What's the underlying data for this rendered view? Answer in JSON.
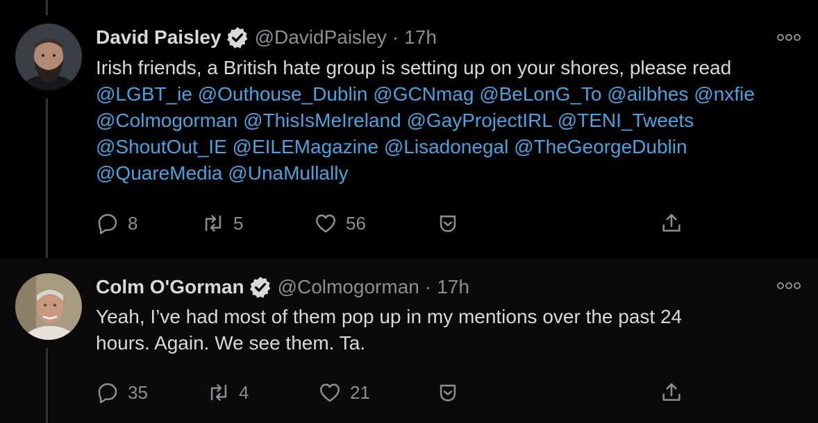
{
  "tweets": [
    {
      "author": {
        "name": "David Paisley",
        "handle": "@DavidPaisley",
        "verified": true,
        "avatar": "bearded-man-avatar"
      },
      "separator": "·",
      "time": "17h",
      "text_intro": "Irish friends, a British hate group is setting up on your shores, please read",
      "mentions": [
        "@LGBT_ie",
        "@Outhouse_Dublin",
        "@GCNmag",
        "@BeLonG_To",
        "@ailbhes",
        "@nxfie",
        "@Colmogorman",
        "@ThisIsMeIreland",
        "@GayProjectIRL",
        "@TENI_Tweets",
        "@ShoutOut_IE",
        "@EILEMagazine",
        "@Lisadonegal",
        "@TheGeorgeDublin",
        "@QuareMedia",
        "@UnaMullally"
      ],
      "actions": {
        "replies": "8",
        "retweets": "5",
        "likes": "56"
      }
    },
    {
      "author": {
        "name": "Colm O'Gorman",
        "handle": "@Colmogorman",
        "verified": true,
        "avatar": "grey-haired-man-avatar"
      },
      "separator": "·",
      "time": "17h",
      "text_lines": [
        "Yeah, I’ve had most of them pop up in my mentions over the past 24",
        "hours. Again. We see them. Ta."
      ],
      "actions": {
        "replies": "35",
        "retweets": "4",
        "likes": "21"
      }
    }
  ],
  "icons": {
    "verified": "verified-badge-icon",
    "more": "more-options-icon",
    "reply": "reply-icon",
    "retweet": "retweet-icon",
    "like": "like-icon",
    "save": "save-icon",
    "share": "share-icon"
  },
  "colors": {
    "background": "#000000",
    "mention": "#4aa3df",
    "secondary_text": "#8b8f94",
    "verified_badge": "#d9d9d9"
  }
}
